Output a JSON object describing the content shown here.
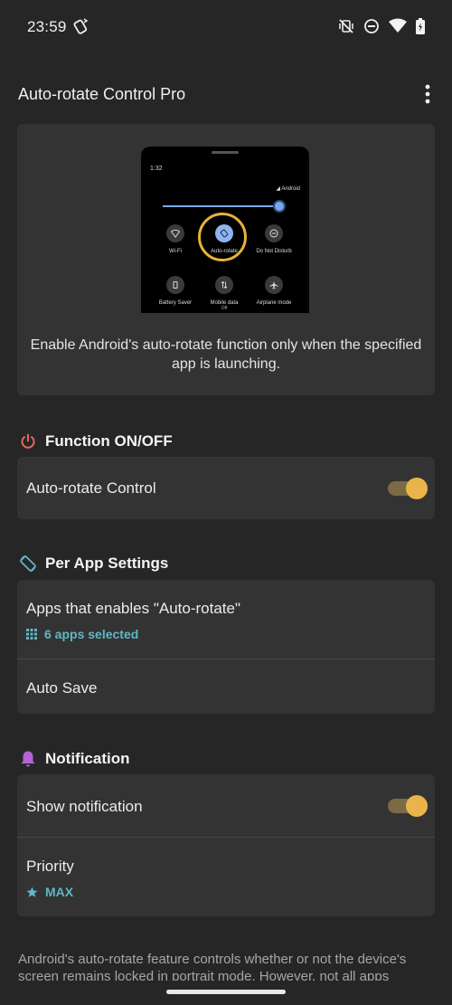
{
  "status_bar": {
    "time": "23:59",
    "left_icon": "rotate-phone-icon",
    "right_icons": [
      "vibrate-off-icon",
      "do-not-disturb-icon",
      "wifi-icon",
      "battery-icon"
    ]
  },
  "app_bar": {
    "title": "Auto-rotate Control Pro",
    "overflow_icon": "more-vertical-icon"
  },
  "hero": {
    "phone_time": "1:32",
    "phone_carrier": "Android",
    "tiles": [
      {
        "label": "Wi-Fi",
        "icon": "wifi-icon"
      },
      {
        "label": "Auto-rotate",
        "icon": "auto-rotate-icon"
      },
      {
        "label": "Do Not Disturb",
        "icon": "do-not-disturb-icon"
      },
      {
        "label": "Battery Saver",
        "icon": "battery-saver-icon"
      },
      {
        "label": "Mobile data",
        "sub": "Off",
        "icon": "mobile-data-icon"
      },
      {
        "label": "Airplane mode",
        "icon": "airplane-icon"
      }
    ],
    "description": "Enable Android's auto-rotate function only when the specified app is launching."
  },
  "sections": {
    "function": {
      "title": "Function ON/OFF",
      "icon": "power-icon",
      "icon_color": "#e5675d",
      "auto_rotate_control": {
        "label": "Auto-rotate Control",
        "enabled": true
      }
    },
    "per_app": {
      "title": "Per App Settings",
      "icon": "screen-rotation-icon",
      "icon_color": "#5fb7c5",
      "apps": {
        "label": "Apps that enables \"Auto-rotate\"",
        "value": "6 apps selected",
        "value_icon": "apps-grid-icon"
      },
      "auto_save": {
        "label": "Auto Save"
      }
    },
    "notification": {
      "title": "Notification",
      "icon": "bell-icon",
      "icon_color": "#b363d6",
      "show_notification": {
        "label": "Show notification",
        "enabled": true
      },
      "priority": {
        "label": "Priority",
        "value": "MAX",
        "value_icon": "star-icon"
      }
    }
  },
  "footer": {
    "text": "Android's auto-rotate feature controls whether or not the device's screen remains locked in portrait mode. However, not all apps"
  },
  "colors": {
    "background": "#262626",
    "card": "#333333",
    "accent_teal": "#5fb7c5",
    "toggle_on": "#e9b54a"
  }
}
